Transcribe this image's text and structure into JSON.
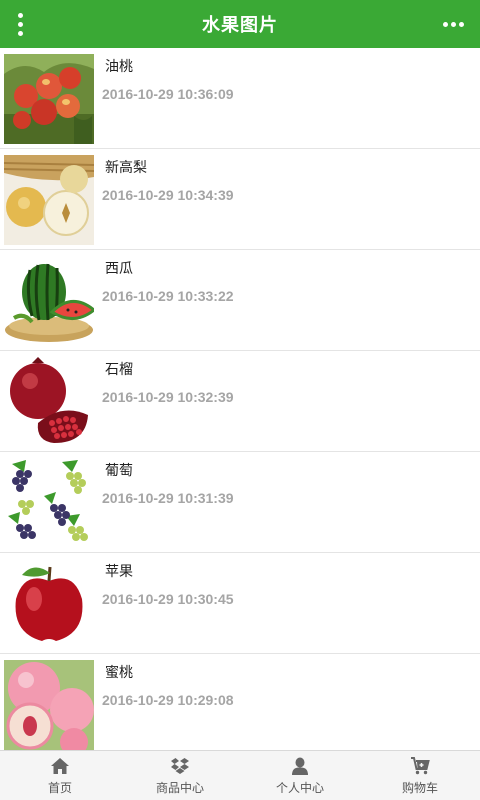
{
  "header": {
    "title": "水果图片",
    "accent_color": "#3aa935"
  },
  "items": [
    {
      "name": "油桃",
      "date": "2016-10-29 10:36:09",
      "icon": "nectarine-image"
    },
    {
      "name": "新高梨",
      "date": "2016-10-29 10:34:39",
      "icon": "pear-image"
    },
    {
      "name": "西瓜",
      "date": "2016-10-29 10:33:22",
      "icon": "watermelon-image"
    },
    {
      "name": "石榴",
      "date": "2016-10-29 10:32:39",
      "icon": "pomegranate-image"
    },
    {
      "name": "葡萄",
      "date": "2016-10-29 10:31:39",
      "icon": "grape-image"
    },
    {
      "name": "苹果",
      "date": "2016-10-29 10:30:45",
      "icon": "apple-image"
    },
    {
      "name": "蜜桃",
      "date": "2016-10-29 10:29:08",
      "icon": "peach-image"
    }
  ],
  "tabbar": [
    {
      "label": "首页",
      "icon": "home-icon"
    },
    {
      "label": "商品中心",
      "icon": "dropbox-icon"
    },
    {
      "label": "个人中心",
      "icon": "user-icon"
    },
    {
      "label": "购物车",
      "icon": "cart-icon"
    }
  ]
}
